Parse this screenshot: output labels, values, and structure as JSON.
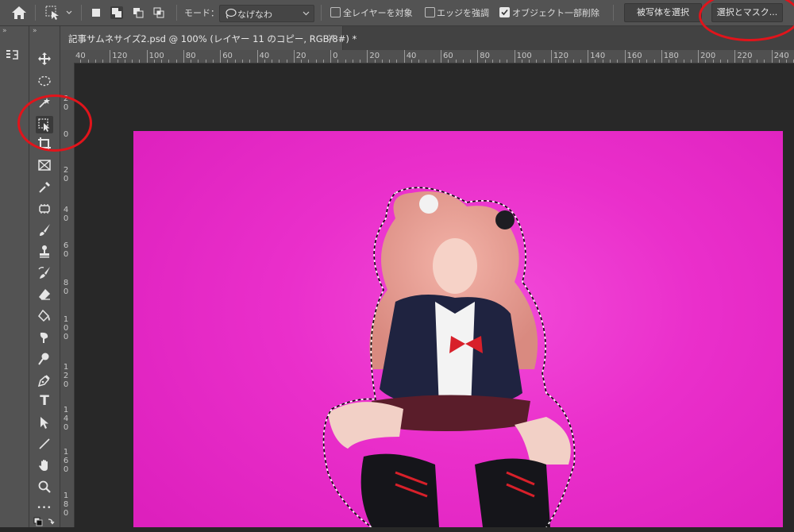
{
  "options_bar": {
    "mode_label": "モード：",
    "lasso_mode": "なげなわ",
    "sample_all_layers": {
      "label": "全レイヤーを対象",
      "checked": false
    },
    "enhance_edge": {
      "label": "エッジを強調",
      "checked": false
    },
    "object_subtract": {
      "label": "オブジェクト一部削除",
      "checked": true
    },
    "select_subject_label": "被写体を選択",
    "select_and_mask_label": "選択とマスク..."
  },
  "document_tab": {
    "title": "記事サムネサイズ2.psd @ 100% (レイヤー 11 のコピー, RGB/8#) *",
    "close": "×"
  },
  "ruler": {
    "horizontal": [
      "40",
      "120",
      "100",
      "80",
      "60",
      "40",
      "20",
      "0",
      "20",
      "40",
      "60",
      "80",
      "100",
      "120",
      "140",
      "160",
      "180",
      "200",
      "220",
      "240"
    ],
    "vertical": [
      "2\n0",
      "0",
      "2\n0",
      "4\n0",
      "6\n0",
      "8\n0",
      "1\n0\n0",
      "1\n2\n0",
      "1\n4\n0",
      "1\n6\n0",
      "1\n8\n0"
    ]
  },
  "toolbar": {
    "type_tool_glyph": "T",
    "more_tools_glyph": "•••"
  },
  "annotation_color": "#e1141b",
  "canvas_color": "#ea2fcb"
}
